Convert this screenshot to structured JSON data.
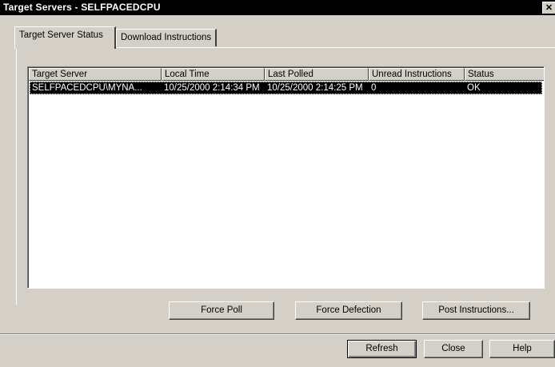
{
  "window": {
    "title": "Target Servers - SELFPACEDCPU",
    "close_glyph": "✕"
  },
  "tabs": [
    {
      "label": "Target Server Status",
      "active": true
    },
    {
      "label": "Download Instructions",
      "active": false
    }
  ],
  "table": {
    "columns": [
      "Target Server",
      "Local Time",
      "Last Polled",
      "Unread Instructions",
      "Status"
    ],
    "rows": [
      {
        "target_server": "SELFPACEDCPU\\MYNA...",
        "local_time": "10/25/2000 2:14:34 PM",
        "last_polled": "10/25/2000 2:14:25 PM",
        "unread_instructions": "0",
        "status": "OK",
        "selected": true
      }
    ]
  },
  "actions": {
    "force_poll": "Force Poll",
    "force_defection": "Force Defection",
    "post_instructions": "Post Instructions..."
  },
  "footer": {
    "refresh": "Refresh",
    "close": "Close",
    "help": "Help"
  },
  "colors": {
    "titlebar": "#000000",
    "face": "#d4d0c8",
    "selection": "#000000",
    "list_background": "#ffffff"
  }
}
